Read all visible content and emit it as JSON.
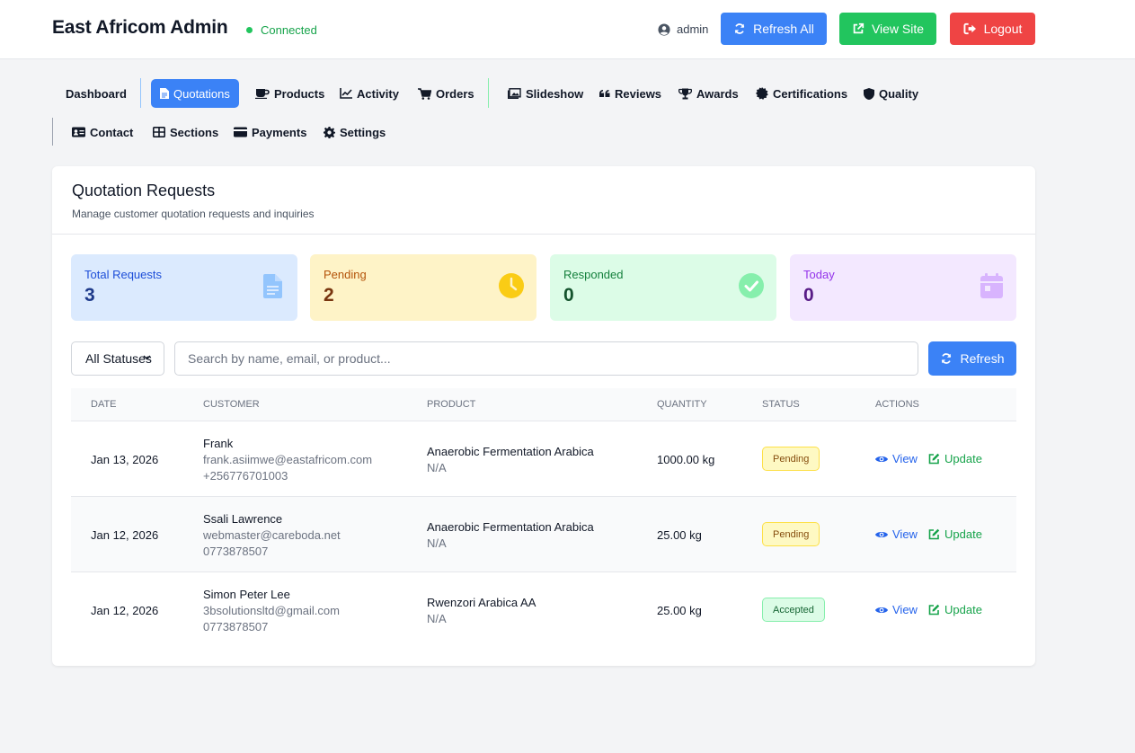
{
  "header": {
    "brand": "East Africom Admin",
    "connection_status": "Connected",
    "user": "admin",
    "refresh_all": "Refresh All",
    "view_site": "View Site",
    "logout": "Logout"
  },
  "nav": {
    "dashboard": "Dashboard",
    "quotations": "Quotations",
    "products": "Products",
    "activity": "Activity",
    "orders": "Orders",
    "slideshow": "Slideshow",
    "reviews": "Reviews",
    "awards": "Awards",
    "certifications": "Certifications",
    "quality": "Quality",
    "contact": "Contact",
    "sections": "Sections",
    "payments": "Payments",
    "settings": "Settings"
  },
  "page": {
    "title": "Quotation Requests",
    "subtitle": "Manage customer quotation requests and inquiries"
  },
  "stats": [
    {
      "label": "Total Requests",
      "value": "3",
      "icon": "document-icon"
    },
    {
      "label": "Pending",
      "value": "2",
      "icon": "clock-icon"
    },
    {
      "label": "Responded",
      "value": "0",
      "icon": "check-circle-icon"
    },
    {
      "label": "Today",
      "value": "0",
      "icon": "calendar-icon"
    }
  ],
  "filters": {
    "status_selected": "All Statuses",
    "search_placeholder": "Search by name, email, or product...",
    "refresh_label": "Refresh"
  },
  "table": {
    "columns": [
      "Date",
      "Customer",
      "Product",
      "Quantity",
      "Status",
      "Actions"
    ],
    "rows": [
      {
        "date": "Jan 13, 2026",
        "name": "Frank",
        "email": "frank.asiimwe@eastafricom.com",
        "phone": "+256776701003",
        "product": "Anaerobic Fermentation Arabica",
        "product_sub": "N/A",
        "quantity": "1000.00 kg",
        "status": "Pending",
        "view": "View",
        "update": "Update"
      },
      {
        "date": "Jan 12, 2026",
        "name": "Ssali Lawrence",
        "email": "webmaster@careboda.net",
        "phone": "0773878507",
        "product": "Anaerobic Fermentation Arabica",
        "product_sub": "N/A",
        "quantity": "25.00 kg",
        "status": "Pending",
        "view": "View",
        "update": "Update"
      },
      {
        "date": "Jan 12, 2026",
        "name": "Simon Peter Lee",
        "email": "3bsolutionsltd@gmail.com",
        "phone": "0773878507",
        "product": "Rwenzori Arabica AA",
        "product_sub": "N/A",
        "quantity": "25.00 kg",
        "status": "Accepted",
        "view": "View",
        "update": "Update"
      }
    ]
  },
  "colors": {
    "primary": "#3b82f6",
    "success": "#22c55e",
    "danger": "#ef4444"
  }
}
